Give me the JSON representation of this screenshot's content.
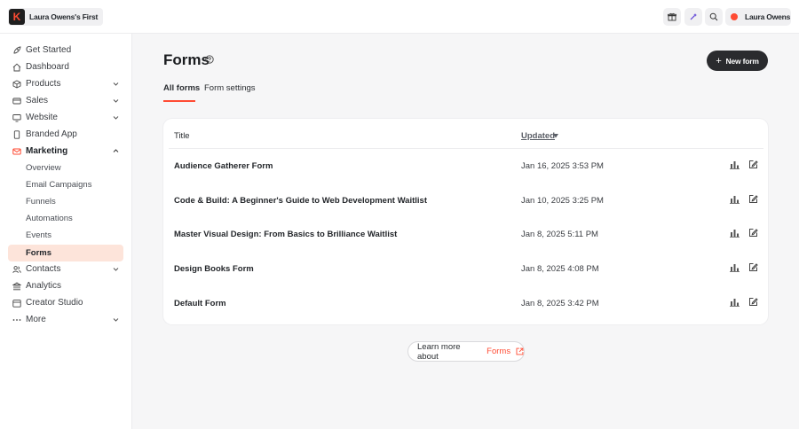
{
  "topbar": {
    "brand_name": "Laura Owens's First",
    "brand_logo_letter": "K",
    "user_name": "Laura Owens",
    "icons": [
      "gift-icon",
      "sparkle-icon",
      "search-icon"
    ]
  },
  "sidebar": {
    "items": [
      {
        "label": "Get Started",
        "icon": "rocket-icon"
      },
      {
        "label": "Dashboard",
        "icon": "home-icon"
      },
      {
        "label": "Products",
        "icon": "box-icon"
      },
      {
        "label": "Sales",
        "icon": "card-icon"
      },
      {
        "label": "Website",
        "icon": "monitor-icon"
      },
      {
        "label": "Branded App",
        "icon": "phone-icon"
      },
      {
        "label": "Marketing",
        "icon": "mail-icon"
      },
      {
        "label": "Contacts",
        "icon": "users-icon"
      },
      {
        "label": "Analytics",
        "icon": "bank-icon"
      },
      {
        "label": "Creator Studio",
        "icon": "calendar-icon"
      },
      {
        "label": "More",
        "icon": "dots-icon"
      }
    ],
    "marketing_sub": [
      "Overview",
      "Email Campaigns",
      "Funnels",
      "Automations",
      "Events",
      "Forms"
    ]
  },
  "main": {
    "title": "Forms",
    "new_form_label": "New form",
    "tabs": [
      "All forms",
      "Form settings"
    ],
    "table": {
      "col_title": "Title",
      "col_updated": "Updated",
      "rows": [
        {
          "title": "Audience Gatherer Form",
          "updated": "Jan 16, 2025 3:53 PM"
        },
        {
          "title": "Code & Build: A Beginner's Guide to Web Development Waitlist",
          "updated": "Jan 10, 2025 3:25 PM"
        },
        {
          "title": "Master Visual Design: From Basics to Brilliance Waitlist",
          "updated": "Jan 8, 2025 5:11 PM"
        },
        {
          "title": "Design Books Form",
          "updated": "Jan 8, 2025 4:08 PM"
        },
        {
          "title": "Default Form",
          "updated": "Jan 8, 2025 3:42 PM"
        }
      ]
    },
    "learn_more_prefix": "Learn more about",
    "learn_more_link": "Forms"
  },
  "colors": {
    "accent": "#ff4b33",
    "selected_bg": "#fde4da",
    "button_dark": "#2a2b2e"
  }
}
